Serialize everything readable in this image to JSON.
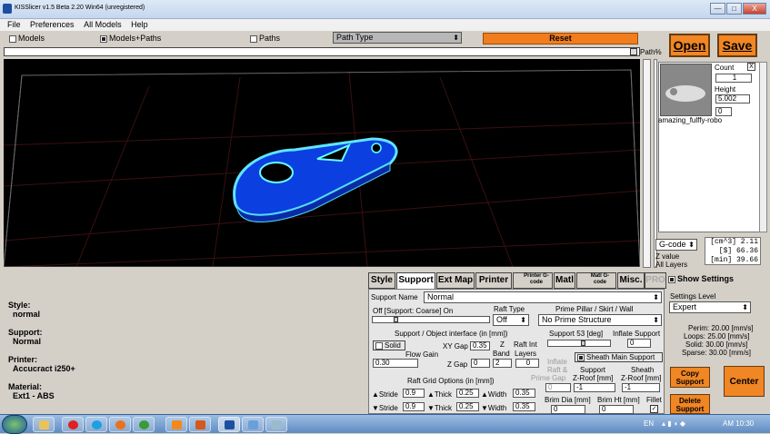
{
  "window": {
    "title": "KISSlicer v1.5 Beta 2.20 Win64 (unregistered)",
    "min": "—",
    "max": "□",
    "close": "X"
  },
  "menu": [
    "File",
    "Preferences",
    "All Models",
    "Help"
  ],
  "viewopts": {
    "models": "Models",
    "models_paths": "Models+Paths",
    "paths": "Paths",
    "path_type": "Path Type",
    "reset": "Reset",
    "path_pct": "Path%"
  },
  "buttons": {
    "open": "Open",
    "save": "Save"
  },
  "model": {
    "count_label": "Count",
    "count": "1",
    "height_label": "Height",
    "height": "5.002",
    "rot": "0",
    "name": "amazing_fulffy-robo",
    "close": "X"
  },
  "gcode": {
    "label": "G-code",
    "zvalue": "Z value",
    "all_layers": "All Layers",
    "stats": [
      "[cm^3]  2.11",
      "[$]  66.36",
      "[min]  39.66"
    ]
  },
  "summary": {
    "style_label": "Style:",
    "style": "normal",
    "support_label": "Support:",
    "support": "Normal",
    "printer_label": "Printer:",
    "printer": "Accucract i250+",
    "material_label": "Material:",
    "material": "Ext1 - ABS"
  },
  "tabs": {
    "style": "Style",
    "support": "Support",
    "extmap": "Ext Map",
    "printer": "Printer",
    "printer_gcode": "Printer G-code",
    "matl": "Matl",
    "matl_gcode": "Matl G-code",
    "misc": "Misc.",
    "pro": "PRO"
  },
  "support": {
    "name_label": "Support Name",
    "name": "Normal",
    "coarse": "Off [Support: Coarse] On",
    "raft_type_label": "Raft Type",
    "raft_type": "Off",
    "prime_label": "Prime Pillar / Skirt / Wall",
    "prime": "No Prime Structure",
    "interface_label": "Support / Object interface (in [mm])",
    "support_deg": "Support 53 [deg]",
    "inflate": "Inflate Support",
    "inflate_val": "0",
    "solid": "Solid",
    "xygap_label": "XY Gap",
    "xygap": "0.35",
    "z_label": "Z",
    "band_label": "Band",
    "raftint_label": "Raft Int",
    "layers_label": "Layers",
    "flowgain_label": "Flow Gain",
    "flow": "0.30",
    "zgap_label": "Z Gap",
    "zgap": "0",
    "band": "2",
    "layers": "0",
    "sheath": "Sheath Main Support",
    "inflate_raft": "Inflate",
    "raft_and": "Raft &",
    "prime_gap": "Prime Gap",
    "prime_gap_val": "0",
    "support_zroof_l1": "Support",
    "support_zroof_l2": "Z-Roof [mm]",
    "support_zroof": "-1",
    "sheath_zroof_l1": "Sheath",
    "sheath_zroof_l2": "Z-Roof [mm]",
    "sheath_zroof": "-1",
    "raftgrid": "Raft Grid Options (in [mm])",
    "stride_label": "Stride",
    "stride1": "0.9",
    "stride2": "0.9",
    "thick_label": "Thick",
    "thick1": "0.25",
    "thick2": "0.25",
    "width_label": "Width",
    "width1": "0.35",
    "width2": "0.35",
    "brim_dia": "Brim Dia [mm]",
    "brim_ht": "Brim Ht [mm]",
    "fillet": "Fillet",
    "brim_dia_val": "0",
    "brim_ht_val": "0"
  },
  "settings": {
    "show": "Show Settings",
    "level_label": "Settings Level",
    "level": "Expert",
    "perim": "Perim: 20.00 [mm/s]",
    "loops": "Loops: 25.00 [mm/s]",
    "solid": "Solid: 30.00 [mm/s]",
    "sparse": "Sparse: 30.00 [mm/s]",
    "copy": "Copy Support",
    "delete": "Delete Support",
    "center": "Center"
  },
  "taskbar": {
    "lang": "EN",
    "time": "AM 10:30"
  }
}
